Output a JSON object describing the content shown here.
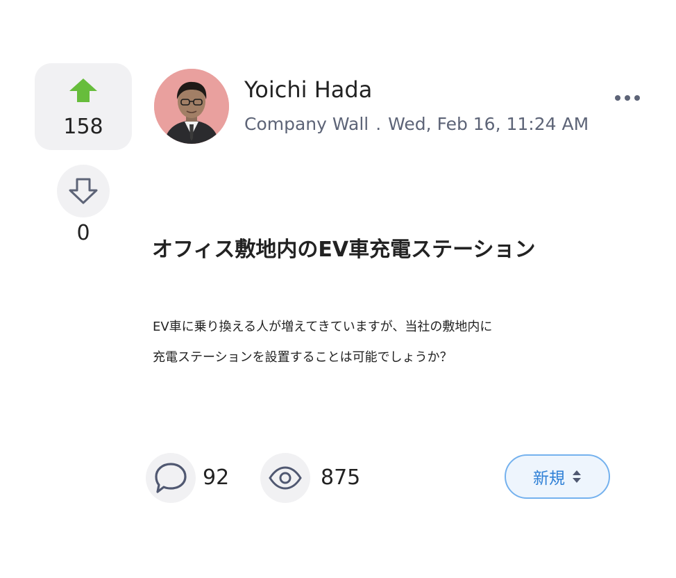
{
  "votes": {
    "up_count": "158",
    "down_count": "0",
    "up_color": "#67bd3c"
  },
  "author": {
    "name": "Yoichi Hada",
    "avatar_bg": "#e9a09e"
  },
  "meta": {
    "channel": "Company Wall",
    "separator": ".",
    "timestamp": "Wed, Feb 16, 11:24 AM"
  },
  "post": {
    "title": "オフィス敷地内のEV車充電ステーション",
    "body_lines": [
      "EV車に乗り換える人が増えてきていますが、当社の敷地内に",
      "充電ステーションを設置することは可能でしょうか？"
    ]
  },
  "stats": {
    "comments": "92",
    "views": "875"
  },
  "status": {
    "label": "新規",
    "accent": "#2f80d6",
    "border": "#74b1ee"
  },
  "icons": {
    "upvote": "arrow-up-icon",
    "downvote": "arrow-down-outline-icon",
    "more": "ellipsis-icon",
    "comment": "speech-bubble-icon",
    "view": "eye-icon",
    "status": "sort-caret-icon"
  }
}
